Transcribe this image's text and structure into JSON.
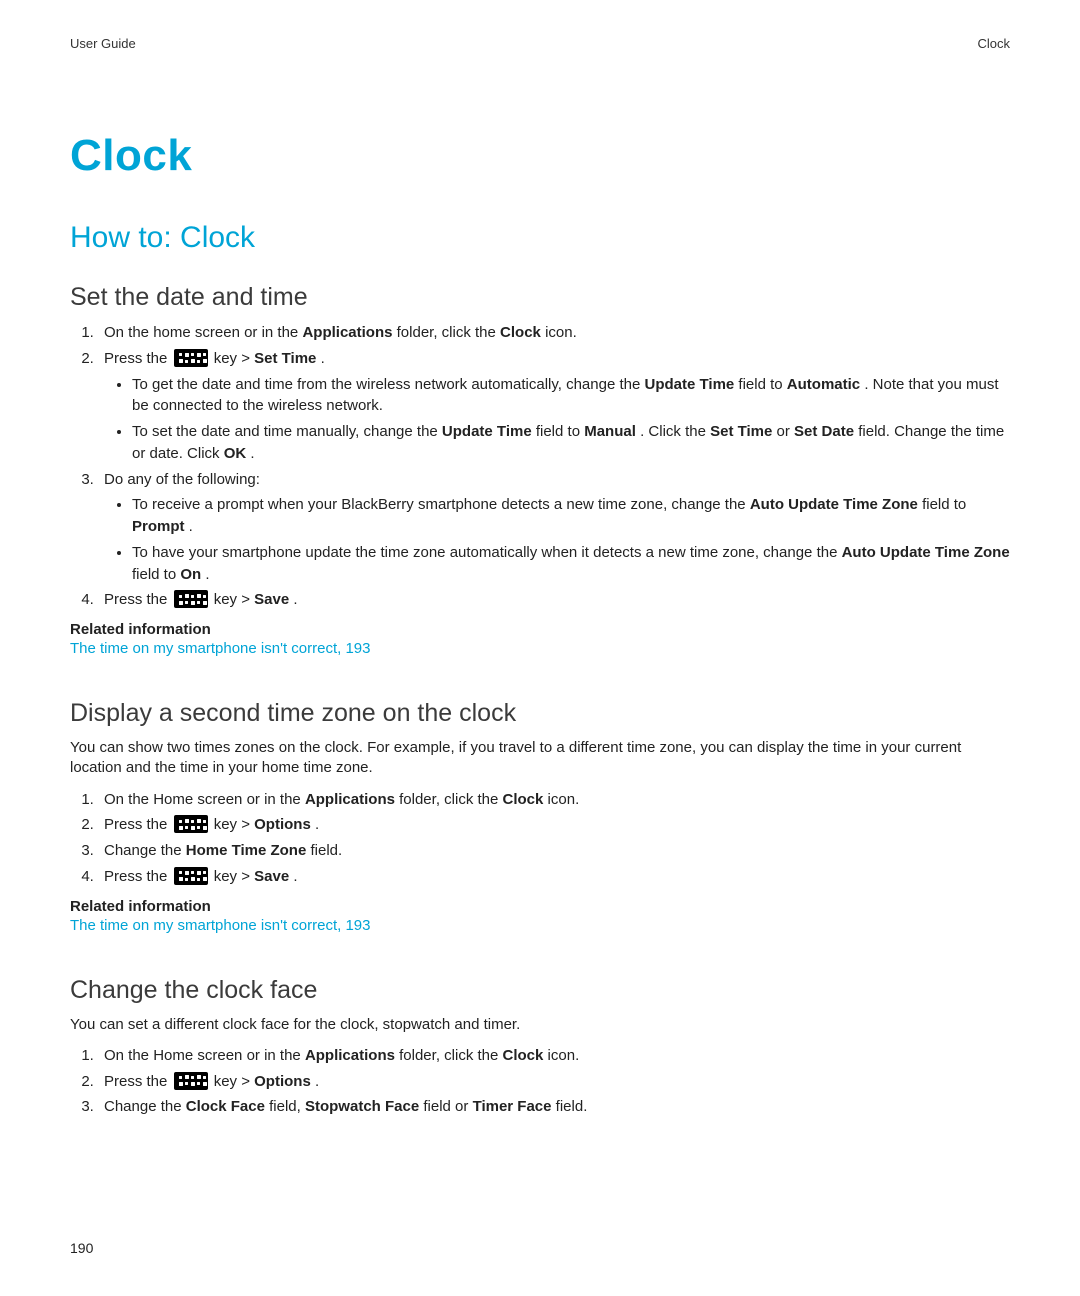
{
  "header": {
    "left": "User Guide",
    "right": "Clock"
  },
  "title": "Clock",
  "howto_heading": "How to: Clock",
  "sec1": {
    "heading": "Set the date and time",
    "step1": {
      "a": "On the home screen or in the ",
      "b": "Applications",
      "c": " folder, click the ",
      "d": "Clock",
      "e": " icon."
    },
    "step2": {
      "a": "Press the ",
      "b": " key > ",
      "c": "Set Time",
      "d": "."
    },
    "step2_sub1": {
      "a": "To get the date and time from the wireless network automatically, change the ",
      "b": "Update Time",
      "c": " field to ",
      "d": "Automatic",
      "e": ". Note that you must be connected to the wireless network."
    },
    "step2_sub2": {
      "a": "To set the date and time manually, change the ",
      "b": "Update Time",
      "c": " field to ",
      "d": "Manual",
      "e": ". Click the ",
      "f": "Set Time",
      "g": " or ",
      "h": "Set Date",
      "i": " field. Change the time or date. Click ",
      "j": "OK",
      "k": "."
    },
    "step3": {
      "a": "Do any of the following:"
    },
    "step3_sub1": {
      "a": "To receive a prompt when your BlackBerry smartphone detects a new time zone, change the ",
      "b": "Auto Update Time Zone",
      "c": " field to ",
      "d": "Prompt",
      "e": "."
    },
    "step3_sub2": {
      "a": "To have your smartphone update the time zone automatically when it detects a new time zone, change the ",
      "b": "Auto Update Time Zone",
      "c": " field to ",
      "d": "On",
      "e": "."
    },
    "step4": {
      "a": "Press the ",
      "b": " key > ",
      "c": "Save",
      "d": "."
    },
    "related_heading": "Related information",
    "related_link": "The time on my smartphone isn't correct, 193"
  },
  "sec2": {
    "heading": "Display a second time zone on the clock",
    "intro": "You can show two times zones on the clock. For example, if you travel to a different time zone, you can display the time in your current location and the time in your home time zone.",
    "step1": {
      "a": "On the Home screen or in the ",
      "b": "Applications",
      "c": " folder, click the ",
      "d": "Clock",
      "e": " icon."
    },
    "step2": {
      "a": "Press the ",
      "b": " key > ",
      "c": "Options",
      "d": "."
    },
    "step3": {
      "a": "Change the ",
      "b": "Home Time Zone",
      "c": " field."
    },
    "step4": {
      "a": "Press the ",
      "b": " key > ",
      "c": "Save",
      "d": "."
    },
    "related_heading": "Related information",
    "related_link": "The time on my smartphone isn't correct, 193"
  },
  "sec3": {
    "heading": "Change the clock face",
    "intro": "You can set a different clock face for the clock, stopwatch and timer.",
    "step1": {
      "a": "On the Home screen or in the ",
      "b": "Applications",
      "c": " folder, click the ",
      "d": "Clock",
      "e": " icon."
    },
    "step2": {
      "a": "Press the ",
      "b": " key > ",
      "c": "Options",
      "d": "."
    },
    "step3": {
      "a": "Change the ",
      "b": "Clock Face",
      "c": " field, ",
      "d": "Stopwatch Face",
      "e": " field or ",
      "f": "Timer Face",
      "g": " field."
    }
  },
  "page_number": "190"
}
